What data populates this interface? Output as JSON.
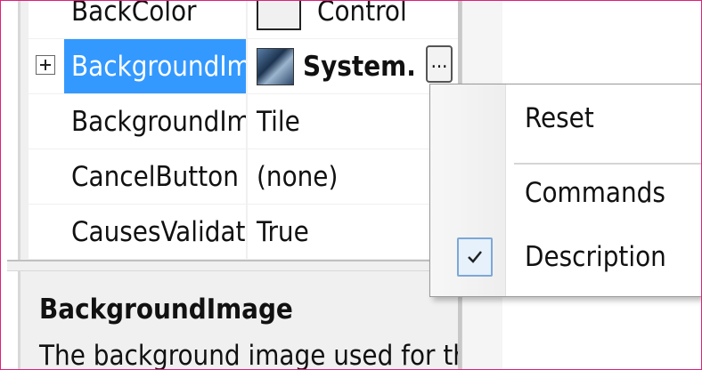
{
  "property_grid": {
    "rows": [
      {
        "name": "BackColor",
        "value": "Control"
      },
      {
        "name": "BackgroundIm",
        "value": "System."
      },
      {
        "name": "BackgroundIm",
        "value": "Tile"
      },
      {
        "name": "CancelButton",
        "value": "(none)"
      },
      {
        "name": "CausesValidatic",
        "value": "True"
      }
    ],
    "selected_row_index": 1,
    "ellipsis_label": "..."
  },
  "description": {
    "title": "BackgroundImage",
    "text": "The background image used for the"
  },
  "context_menu": {
    "items": [
      {
        "label": "Reset",
        "checked": false
      },
      {
        "label": "Commands",
        "checked": false
      },
      {
        "label": "Description",
        "checked": true
      }
    ]
  },
  "colors": {
    "selection": "#3399ff",
    "frame": "#e0207a",
    "check_border": "#7ea7d6"
  }
}
